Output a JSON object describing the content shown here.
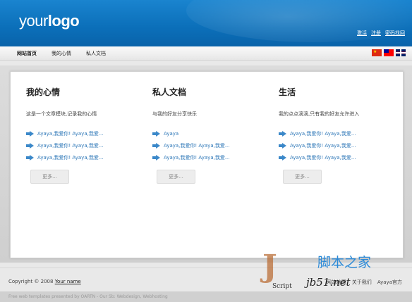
{
  "header": {
    "logo_light": "your",
    "logo_bold": "logo",
    "links": [
      "激活",
      "注册",
      "密码找回"
    ]
  },
  "nav": {
    "items": [
      "网站首页",
      "我的心情",
      "私人文档"
    ],
    "flags": [
      "china-flag-icon",
      "taiwan-flag-icon",
      "uk-flag-icon"
    ]
  },
  "columns": [
    {
      "title": "我的心情",
      "desc": "这是一个文章模块,记录我的心情",
      "links": [
        "Ayaya,我爱你! Ayaya,我爱...",
        "Ayaya,我爱你! Ayaya,我爱...",
        "Ayaya,我爱你! Ayaya,我爱..."
      ],
      "more": "更多..."
    },
    {
      "title": "私人文档",
      "desc": "与我的好友分享快乐",
      "links": [
        "Ayaya",
        "Ayaya,我爱你! Ayaya,我爱...",
        "Ayaya,我爱你! Ayaya,我爱..."
      ],
      "more": "更多..."
    },
    {
      "title": "生活",
      "desc": "我的点点滴滴,只有我的好友允许进入",
      "links": [
        "Ayaya,我爱你! Ayaya,我爱...",
        "Ayaya,我爱你! Ayaya,我爱...",
        "Ayaya,我爱你! Ayaya,我爱..."
      ],
      "more": "更多..."
    }
  ],
  "footer": {
    "copyright_prefix": "Copyright © 2008",
    "copyright_link": "Your name",
    "links": [
      "网站地图",
      "关于我们",
      "Ayaya官方"
    ],
    "credits": "Free web templates presented by OARTN - Our Sb: Webdesign, Webhosting"
  },
  "watermark": {
    "j": "J",
    "script": "Script",
    "title": "脚本之家",
    "url": "jb51.net"
  }
}
